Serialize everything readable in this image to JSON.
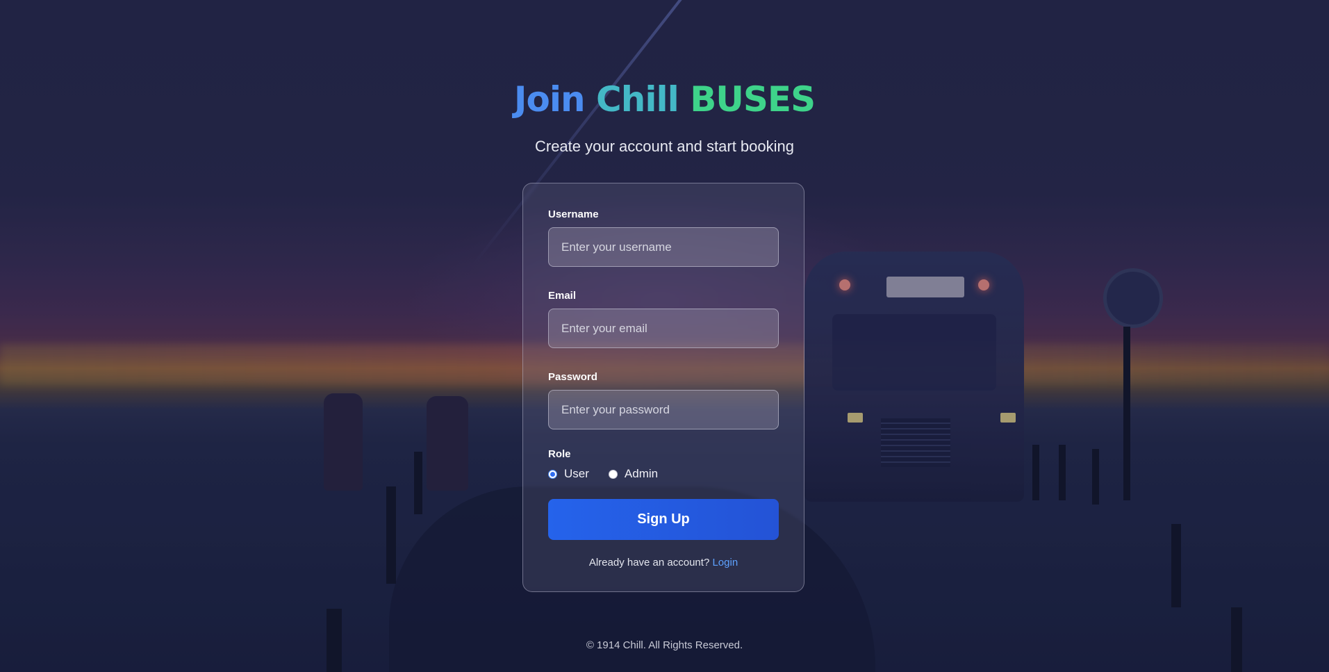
{
  "page": {
    "title_part1": "Join",
    "title_part2": "Chill",
    "title_part3": "BUSES",
    "subtitle": "Create your account and start booking"
  },
  "form": {
    "username_label": "Username",
    "username_placeholder": "Enter your username",
    "email_label": "Email",
    "email_placeholder": "Enter your email",
    "password_label": "Password",
    "password_placeholder": "Enter your password",
    "role_label": "Role",
    "role_options": [
      "User",
      "Admin"
    ],
    "role_selected": "User",
    "submit_label": "Sign Up",
    "login_prompt": "Already have an account?",
    "login_link": "Login"
  },
  "footer": {
    "copyright": "© 1914 Chill. All Rights Reserved."
  },
  "colors": {
    "title_blue": "#4b8cf0",
    "title_teal": "#44b8c6",
    "title_green": "#3ed38a",
    "button": "#2563eb",
    "link": "#5ea2ff"
  }
}
